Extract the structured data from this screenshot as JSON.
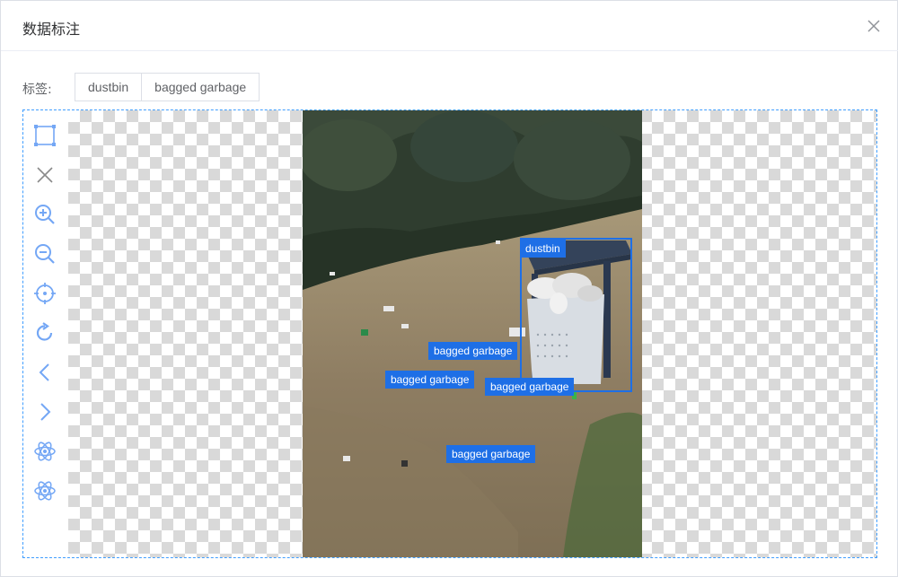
{
  "dialog": {
    "title": "数据标注",
    "close_icon": "close-icon"
  },
  "labels": {
    "title": "标签:",
    "tags": [
      {
        "label": "dustbin"
      },
      {
        "label": "bagged garbage"
      }
    ]
  },
  "toolbar": {
    "tools": [
      {
        "icon": "rect-select-icon"
      },
      {
        "icon": "clear-icon"
      },
      {
        "icon": "zoom-in-icon"
      },
      {
        "icon": "zoom-out-icon"
      },
      {
        "icon": "target-icon"
      },
      {
        "icon": "rotate-icon"
      },
      {
        "icon": "chevron-left-icon"
      },
      {
        "icon": "chevron-right-icon"
      },
      {
        "icon": "atom-icon"
      },
      {
        "icon": "atom-icon"
      }
    ]
  },
  "annotations": [
    {
      "label": "dustbin"
    },
    {
      "label": "bagged garbage"
    },
    {
      "label": "bagged garbage"
    },
    {
      "label": "bagged garbage"
    },
    {
      "label": "bagged garbage"
    }
  ],
  "colors": {
    "accent": "#409eff",
    "annotation": "#1e6fe6"
  }
}
